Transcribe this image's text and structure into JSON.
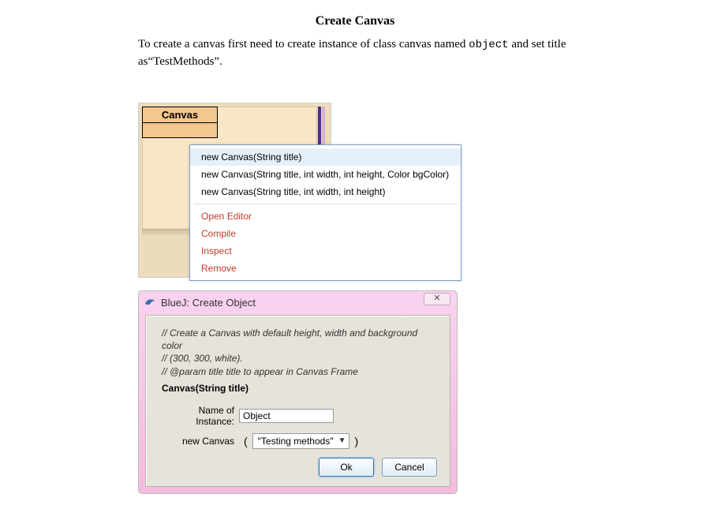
{
  "title": "Create Canvas",
  "intro": {
    "pre": "To create a canvas first need to create instance of class canvas named ",
    "code": "object",
    "post": " and set title as“TestMethods”."
  },
  "class_box_label": "Canvas",
  "ctx_menu": {
    "items": [
      {
        "label": "new Canvas(String title)",
        "red": false,
        "selected": true
      },
      {
        "label": "new Canvas(String title, int width, int height, Color bgColor)",
        "red": false,
        "selected": false
      },
      {
        "label": "new Canvas(String title, int width, int height)",
        "red": false,
        "selected": false
      }
    ],
    "actions": [
      {
        "label": "Open Editor"
      },
      {
        "label": "Compile"
      },
      {
        "label": "Inspect"
      },
      {
        "label": "Remove"
      }
    ]
  },
  "dialog": {
    "title": "BlueJ:  Create Object",
    "close_glyph": "✕",
    "comment1": "// Create a Canvas with default height, width and background color",
    "comment2": "// (300, 300, white).",
    "comment3": "// @param title  title to appear in Canvas Frame",
    "ctor": "Canvas(String title)",
    "name_label": "Name of Instance:",
    "name_value": "Object",
    "param_label": "new Canvas",
    "param_value": "\"Testing  methods\"",
    "ok": "Ok",
    "cancel": "Cancel"
  }
}
